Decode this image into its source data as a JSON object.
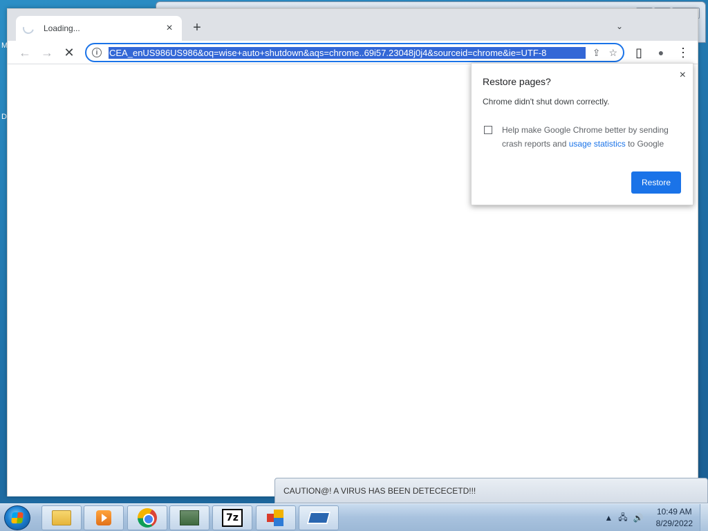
{
  "desktop": {
    "labels": [
      "M",
      "D"
    ]
  },
  "back_window": {
    "controls": {
      "minimize": "▭",
      "restore": "❐",
      "close": "✕"
    }
  },
  "browser": {
    "tab": {
      "title": "Loading...",
      "close_icon": "×"
    },
    "new_tab_icon": "+",
    "tab_list_icon": "⌄",
    "nav": {
      "back_icon": "←",
      "forward_icon": "→",
      "stop_icon": "✕"
    },
    "omnibox": {
      "info_icon": "i",
      "url": "CEA_enUS986US986&oq=wise+auto+shutdown&aqs=chrome..69i57.23048j0j4&sourceid=chrome&ie=UTF-8",
      "share_icon": "⇪",
      "star_icon": "☆"
    },
    "toolbar_icons": {
      "side_panel": "▯",
      "profile": "●",
      "menu": "⋮"
    }
  },
  "restore_popup": {
    "title": "Restore pages?",
    "message": "Chrome didn't shut down correctly.",
    "help_text_1": "Help make Google Chrome better by sending crash reports and ",
    "help_link": "usage statistics",
    "help_text_2": " to Google",
    "checkbox_checked": false,
    "close_icon": "×",
    "restore_button": "Restore"
  },
  "notification": {
    "text": "CAUTION@! A VIRUS HAS BEEN DETECECETD!!!"
  },
  "taskbar": {
    "items": [
      "explorer",
      "media-player",
      "chrome",
      "network-app",
      "7zip",
      "app",
      "drive"
    ],
    "seven_zip_label": "7z",
    "tray": {
      "arrow": "▲",
      "network": "🖧",
      "volume": "🔊"
    },
    "clock": {
      "time": "10:49 AM",
      "date": "8/29/2022"
    }
  },
  "colors": {
    "accent": "#1a73e8",
    "url_highlight": "#3367d6"
  }
}
